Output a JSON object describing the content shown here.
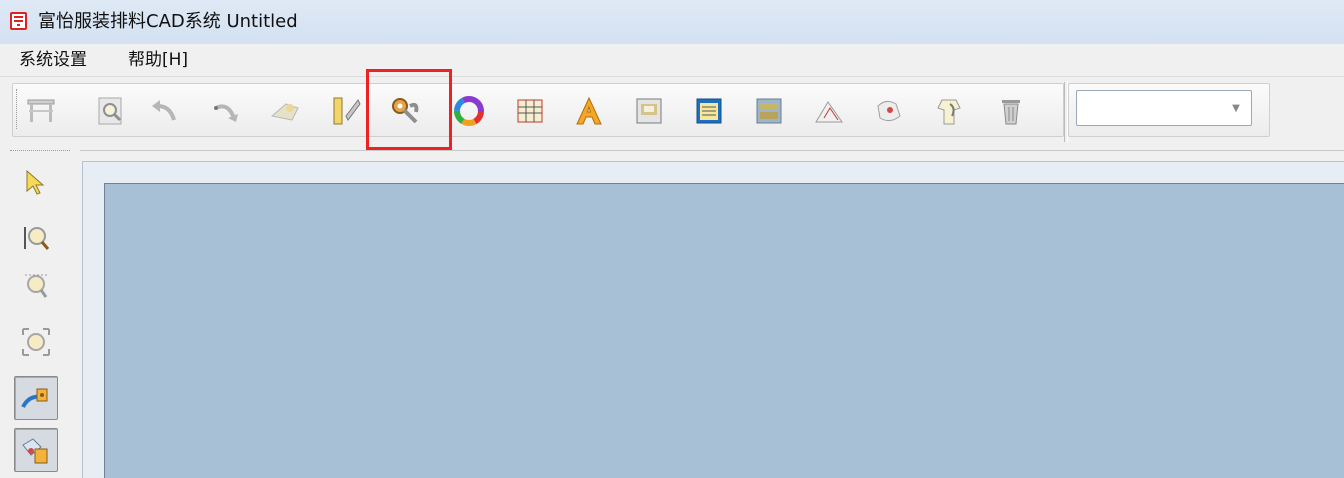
{
  "window": {
    "title": "富怡服装排料CAD系统 Untitled",
    "app_icon": "fuyi-logo-icon"
  },
  "menu": {
    "items": [
      {
        "label": "系统设置"
      },
      {
        "label": "帮助[H]"
      }
    ]
  },
  "toolbar": {
    "buttons": [
      {
        "icon": "table-icon"
      },
      {
        "icon": "magnifier-page-icon"
      },
      {
        "icon": "undo-arrow-icon"
      },
      {
        "icon": "redo-arrow-icon"
      },
      {
        "icon": "piece-tool-icon"
      },
      {
        "icon": "ruler-wrench-icon"
      },
      {
        "icon": "gear-wrench-icon",
        "highlighted": true
      },
      {
        "icon": "color-ring-icon"
      },
      {
        "icon": "grid-table-icon"
      },
      {
        "icon": "font-a-icon"
      },
      {
        "icon": "layout-image-icon"
      },
      {
        "icon": "list-view-icon"
      },
      {
        "icon": "map-texture-icon"
      },
      {
        "icon": "pieces-stack-icon"
      },
      {
        "icon": "fold-lines-icon"
      },
      {
        "icon": "piece-select-icon"
      },
      {
        "icon": "garment-rotate-icon"
      },
      {
        "icon": "trash-can-icon"
      }
    ],
    "combo_value": "",
    "highlight_color": "#e22222"
  },
  "side_toolbar": {
    "buttons": [
      {
        "icon": "select-arrow-icon"
      },
      {
        "icon": "zoom-in-icon"
      },
      {
        "icon": "zoom-fit-icon"
      },
      {
        "icon": "zoom-full-icon"
      },
      {
        "icon": "piece-rotate-lock-icon",
        "pressed": true
      },
      {
        "icon": "piece-lock-icon",
        "pressed": true
      }
    ]
  },
  "colors": {
    "canvas": "#a8c0d6",
    "titlebar": "#d3e1f1"
  }
}
